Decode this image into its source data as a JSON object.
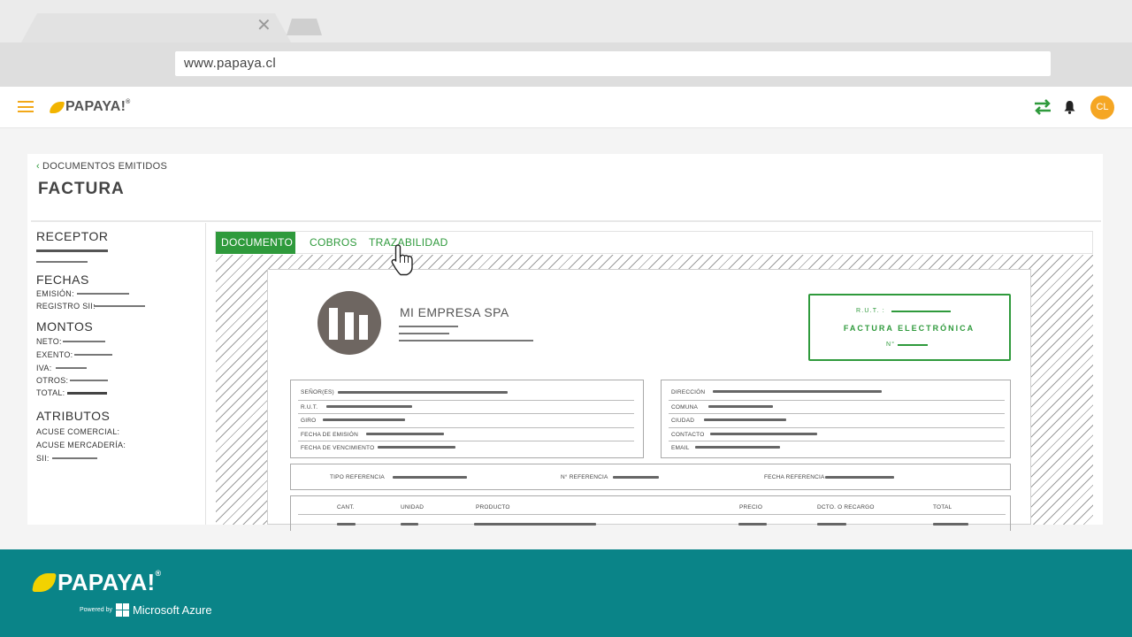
{
  "browser": {
    "url": "www.papaya.cl",
    "close_glyph": "✕"
  },
  "header": {
    "logo_text": "PAPAYA!",
    "logo_mark": "®",
    "avatar_initials": "CL",
    "icons": [
      "menu-icon",
      "sync-arrows-icon",
      "bell-icon"
    ],
    "accent_color": "#2f9a3c",
    "brand_color": "#f5a623"
  },
  "page": {
    "breadcrumb": "DOCUMENTOS EMITIDOS",
    "title": "FACTURA"
  },
  "sidebar": {
    "receptor": "RECEPTOR",
    "fechas": {
      "heading": "FECHAS",
      "emision": "EMISIÓN:",
      "registro": "REGISTRO SII:"
    },
    "montos": {
      "heading": "MONTOS",
      "neto": "NETO:",
      "exento": "EXENTO:",
      "iva": "IVA:",
      "otros": "OTROS:",
      "total": "TOTAL:"
    },
    "atributos": {
      "heading": "ATRIBUTOS",
      "acuse_comercial": "ACUSE COMERCIAL:",
      "acuse_mercaderia": "ACUSE MERCADERÍA:",
      "sii": "SII:"
    }
  },
  "tabs": [
    {
      "label": "DOCUMENTO",
      "active": true
    },
    {
      "label": "COBROS",
      "active": false
    },
    {
      "label": "TRAZABILIDAD",
      "active": false
    }
  ],
  "document": {
    "company": "MI EMPRESA SPA",
    "rut_label": "R.U.T. :",
    "doc_type": "FACTURA ELECTRÓNICA",
    "number_label": "N°",
    "left_fields": [
      "SEÑOR(ES)",
      "R.U.T.",
      "GIRO",
      "FECHA DE EMISIÓN",
      "FECHA DE VENCIMIENTO"
    ],
    "right_fields": [
      "DIRECCIÓN",
      "COMUNA",
      "CIUDAD",
      "CONTACTO",
      "EMAIL"
    ],
    "reference_fields": [
      "TIPO REFERENCIA",
      "N° REFERENCIA",
      "FECHA REFERENCIA"
    ],
    "table_headers": [
      "CANT.",
      "UNIDAD",
      "PRODUCTO",
      "PRECIO",
      "DCTO. O RECARGO",
      "TOTAL"
    ]
  },
  "footer": {
    "logo_text": "PAPAYA!",
    "logo_mark": "®",
    "powered_by": "Powered by",
    "partner": "Microsoft Azure"
  }
}
